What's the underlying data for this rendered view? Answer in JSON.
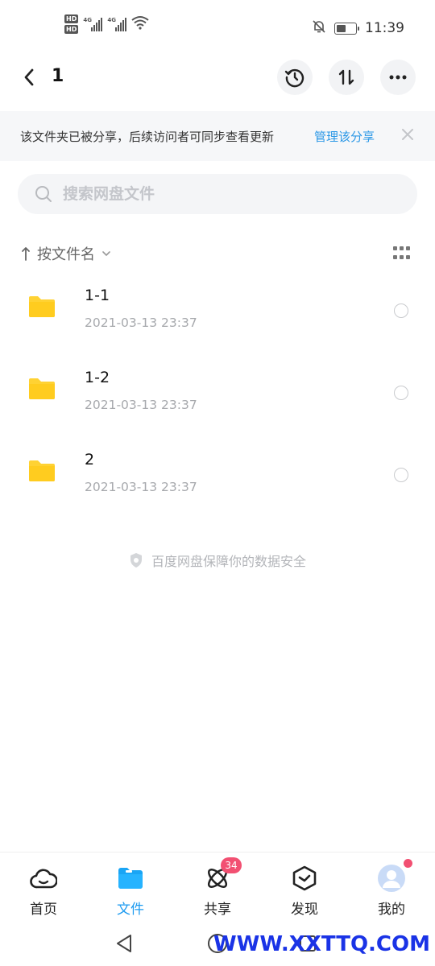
{
  "status_bar": {
    "hd1": "HD",
    "hd2": "HD",
    "net1": "4G",
    "net2": "4G",
    "battery_level": 0.5,
    "time": "11:39"
  },
  "header": {
    "title": "1"
  },
  "banner": {
    "text": "该文件夹已被分享，后续访问者可同步查看更新",
    "link": "管理该分享"
  },
  "search": {
    "placeholder": "搜索网盘文件"
  },
  "sort": {
    "label": "按文件名"
  },
  "files": [
    {
      "name": "1-1",
      "date": "2021-03-13  23:37"
    },
    {
      "name": "1-2",
      "date": "2021-03-13  23:37"
    },
    {
      "name": "2",
      "date": "2021-03-13  23:37"
    }
  ],
  "footnote": "百度网盘保障你的数据安全",
  "bottom_nav": {
    "home": "首页",
    "files": "文件",
    "share": "共享",
    "share_badge": "34",
    "discover": "发现",
    "me": "我的"
  },
  "watermark": "WWW.XXTTQ.COM",
  "colors": {
    "accent": "#1d9bf0",
    "link": "#2a97e6",
    "folder": "#ffd233",
    "badge": "#f25072"
  }
}
